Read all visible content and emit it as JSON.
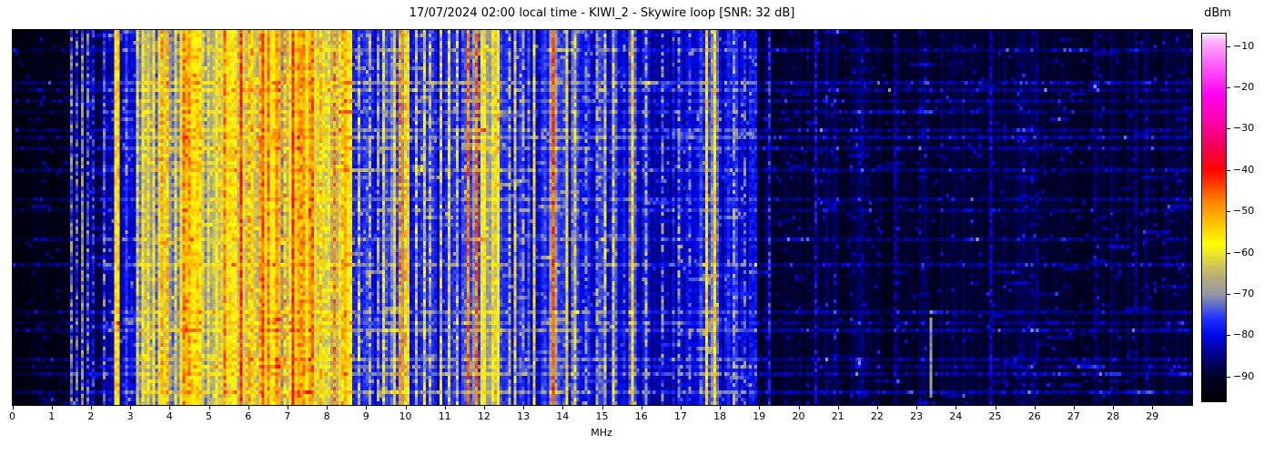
{
  "chart_data": {
    "type": "heatmap",
    "title": "17/07/2024 02:00 local time - KIWI_2 - Skywire loop [SNR: 32 dB]",
    "xlabel": "MHz",
    "x_range": [
      0,
      30
    ],
    "x_ticks": [
      0,
      1,
      2,
      3,
      4,
      5,
      6,
      7,
      8,
      9,
      10,
      11,
      12,
      13,
      14,
      15,
      16,
      17,
      18,
      19,
      20,
      21,
      22,
      23,
      24,
      25,
      26,
      27,
      28,
      29
    ],
    "colorbar_label": "dBm",
    "colorbar_ticks": [
      -10,
      -20,
      -30,
      -40,
      -50,
      -60,
      -70,
      -80,
      -90
    ],
    "value_range": [
      -96,
      -7
    ],
    "legend_position": "right",
    "grid_visible": false,
    "colormap_stops": [
      [
        -96,
        "#000000"
      ],
      [
        -90,
        "#000028"
      ],
      [
        -85,
        "#000080"
      ],
      [
        -80,
        "#0008e8"
      ],
      [
        -76,
        "#2030ff"
      ],
      [
        -73,
        "#5868cf"
      ],
      [
        -70,
        "#9796a4"
      ],
      [
        -66,
        "#b6ae79"
      ],
      [
        -62,
        "#dcd348"
      ],
      [
        -58,
        "#ffff00"
      ],
      [
        -53,
        "#ffc400"
      ],
      [
        -48,
        "#ff8800"
      ],
      [
        -44,
        "#ff4400"
      ],
      [
        -40,
        "#ff0400"
      ],
      [
        -34,
        "#f2005e"
      ],
      [
        -28,
        "#ff00b0"
      ],
      [
        -22,
        "#ff00f0"
      ],
      [
        -15,
        "#ff58fa"
      ],
      [
        -9,
        "#ffb0fa"
      ],
      [
        -7,
        "#fceeff"
      ]
    ],
    "grid": {
      "cols": 431,
      "rows": 103
    },
    "seed": 20240717,
    "noise": {
      "cell_sigma_scale": 0.65,
      "col_sigma_scale": 1.4,
      "spike_prob": 0.035,
      "spike_max": 8,
      "dash_prob": 0.005
    },
    "bands": [
      [
        0.0,
        1.45,
        -93,
        1.5
      ],
      [
        1.45,
        2.28,
        -89.5,
        2.5
      ],
      [
        2.28,
        2.56,
        -83,
        3.5
      ],
      [
        2.56,
        2.74,
        -63,
        5
      ],
      [
        2.74,
        3.12,
        -81,
        4.5
      ],
      [
        3.12,
        3.72,
        -67,
        6.5
      ],
      [
        3.72,
        4.02,
        -62,
        6.5
      ],
      [
        4.02,
        4.28,
        -72,
        6.5
      ],
      [
        4.28,
        4.62,
        -57,
        6.5
      ],
      [
        4.62,
        4.88,
        -63,
        6.5
      ],
      [
        4.88,
        5.12,
        -71,
        7
      ],
      [
        5.12,
        5.62,
        -64,
        7
      ],
      [
        5.62,
        6.16,
        -61,
        6.5
      ],
      [
        6.16,
        6.82,
        -58,
        6
      ],
      [
        6.82,
        7.12,
        -65,
        7
      ],
      [
        7.12,
        7.72,
        -57,
        6
      ],
      [
        7.72,
        8.12,
        -63,
        7
      ],
      [
        8.12,
        8.62,
        -60,
        6.5
      ],
      [
        8.62,
        9.58,
        -77.5,
        4.5
      ],
      [
        9.58,
        10.12,
        -70,
        6.5
      ],
      [
        10.12,
        11.48,
        -77.5,
        4.5
      ],
      [
        11.48,
        11.88,
        -74,
        6
      ],
      [
        11.88,
        12.06,
        -60,
        6
      ],
      [
        12.06,
        12.16,
        -72,
        5
      ],
      [
        12.16,
        12.42,
        -64,
        6
      ],
      [
        12.42,
        13.62,
        -78.5,
        4.5
      ],
      [
        13.62,
        14.42,
        -76,
        5.5
      ],
      [
        14.42,
        15.42,
        -79.5,
        4.5
      ],
      [
        15.42,
        16.16,
        -79.5,
        5
      ],
      [
        16.16,
        17.48,
        -82.5,
        4
      ],
      [
        17.48,
        17.98,
        -75,
        5.5
      ],
      [
        17.98,
        18.92,
        -80.5,
        4.5
      ],
      [
        18.92,
        30.0,
        -89.5,
        2.6
      ]
    ],
    "signal_lines": [
      [
        1.52,
        0.06,
        -73,
        7
      ],
      [
        1.63,
        0.06,
        -76,
        7
      ],
      [
        1.77,
        0.06,
        -72,
        6
      ],
      [
        1.93,
        0.06,
        -75,
        7
      ],
      [
        2.08,
        0.06,
        -79,
        7
      ],
      [
        2.36,
        0.06,
        -75,
        8
      ],
      [
        2.61,
        0.07,
        -56,
        5
      ],
      [
        2.7,
        0.07,
        -57,
        6
      ],
      [
        3.2,
        0.06,
        -63,
        8
      ],
      [
        3.33,
        0.06,
        -60,
        7
      ],
      [
        3.47,
        0.06,
        -62,
        8
      ],
      [
        3.6,
        0.06,
        -59,
        7
      ],
      [
        3.78,
        0.08,
        -51,
        6
      ],
      [
        3.9,
        0.06,
        -55,
        7
      ],
      [
        4.12,
        0.06,
        -60,
        8
      ],
      [
        4.35,
        0.09,
        -48,
        6
      ],
      [
        4.5,
        0.08,
        -50,
        6
      ],
      [
        4.72,
        0.06,
        -57,
        7
      ],
      [
        5.0,
        0.06,
        -63,
        8
      ],
      [
        5.37,
        0.08,
        -48,
        6
      ],
      [
        5.55,
        0.06,
        -58,
        7
      ],
      [
        5.78,
        0.06,
        -43,
        5
      ],
      [
        6.02,
        0.07,
        -52,
        7
      ],
      [
        6.3,
        0.09,
        -51,
        6
      ],
      [
        6.38,
        0.06,
        -45,
        5
      ],
      [
        6.52,
        0.07,
        -48,
        6
      ],
      [
        6.7,
        0.07,
        -51,
        6
      ],
      [
        6.9,
        0.06,
        -52,
        7
      ],
      [
        7.15,
        0.07,
        -42,
        5
      ],
      [
        7.38,
        0.08,
        -50,
        6
      ],
      [
        7.6,
        0.07,
        -47,
        6
      ],
      [
        7.86,
        0.06,
        -55,
        7
      ],
      [
        8.2,
        0.08,
        -49,
        6
      ],
      [
        8.36,
        0.06,
        -53,
        7
      ],
      [
        8.8,
        0.06,
        -67,
        9
      ],
      [
        9.05,
        0.06,
        -69,
        9
      ],
      [
        9.28,
        0.06,
        -71,
        9
      ],
      [
        9.45,
        0.06,
        -62,
        8
      ],
      [
        9.82,
        0.08,
        -49,
        6
      ],
      [
        9.96,
        0.06,
        -54,
        7
      ],
      [
        10.08,
        0.06,
        -59,
        8
      ],
      [
        10.27,
        0.06,
        -66,
        9
      ],
      [
        10.45,
        0.06,
        -63,
        9
      ],
      [
        10.62,
        0.06,
        -68,
        9
      ],
      [
        10.9,
        0.06,
        -64,
        9
      ],
      [
        11.12,
        0.06,
        -62,
        8
      ],
      [
        11.32,
        0.06,
        -67,
        9
      ],
      [
        11.56,
        0.07,
        -47,
        6
      ],
      [
        11.79,
        0.07,
        -47,
        6
      ],
      [
        12.25,
        0.06,
        -61,
        7
      ],
      [
        12.34,
        0.06,
        -62,
        7
      ],
      [
        12.6,
        0.06,
        -69,
        9
      ],
      [
        12.79,
        0.06,
        -63,
        9
      ],
      [
        13.0,
        0.06,
        -71,
        9
      ],
      [
        13.26,
        0.06,
        -61,
        8
      ],
      [
        13.76,
        0.06,
        -44,
        5
      ],
      [
        14.1,
        0.06,
        -61,
        8
      ],
      [
        14.28,
        0.06,
        -64,
        9
      ],
      [
        14.6,
        0.06,
        -73,
        9
      ],
      [
        14.85,
        0.06,
        -71,
        9
      ],
      [
        15.06,
        0.06,
        -66,
        9
      ],
      [
        15.28,
        0.06,
        -64,
        9
      ],
      [
        15.75,
        0.07,
        -57,
        7
      ],
      [
        16.1,
        0.06,
        -70,
        9
      ],
      [
        16.55,
        0.06,
        -74,
        10
      ],
      [
        16.95,
        0.06,
        -72,
        10
      ],
      [
        17.25,
        0.06,
        -76,
        10
      ],
      [
        17.65,
        0.06,
        -57,
        6
      ],
      [
        17.86,
        0.06,
        -56,
        6
      ],
      [
        18.35,
        0.06,
        -72,
        9
      ],
      [
        18.62,
        0.06,
        -76,
        9
      ],
      [
        18.86,
        0.06,
        -80,
        5
      ],
      [
        19.25,
        0.06,
        -79,
        6
      ],
      [
        20.45,
        0.06,
        -81,
        5
      ],
      [
        21.6,
        0.06,
        -85,
        4
      ],
      [
        22.45,
        0.06,
        -85,
        4
      ],
      [
        23.32,
        0.06,
        -70,
        3,
        0.77,
        0.99
      ],
      [
        24.85,
        0.06,
        -82,
        4
      ],
      [
        26.1,
        0.06,
        -86,
        4
      ],
      [
        27.55,
        0.06,
        -87,
        4
      ],
      [
        28.6,
        0.06,
        -86,
        4
      ]
    ],
    "time_streaks": [
      [
        0.053,
        3
      ],
      [
        0.141,
        5
      ],
      [
        0.155,
        4
      ],
      [
        0.187,
        3
      ],
      [
        0.211,
        3
      ],
      [
        0.26,
        3.5
      ],
      [
        0.286,
        5
      ],
      [
        0.316,
        4
      ],
      [
        0.371,
        4
      ],
      [
        0.449,
        3.5
      ],
      [
        0.483,
        2.5
      ],
      [
        0.556,
        3
      ],
      [
        0.629,
        4
      ],
      [
        0.75,
        4
      ],
      [
        0.781,
        3
      ],
      [
        0.803,
        4.5
      ],
      [
        0.886,
        4
      ],
      [
        0.905,
        3
      ],
      [
        0.925,
        4.5
      ],
      [
        0.971,
        5
      ]
    ]
  }
}
